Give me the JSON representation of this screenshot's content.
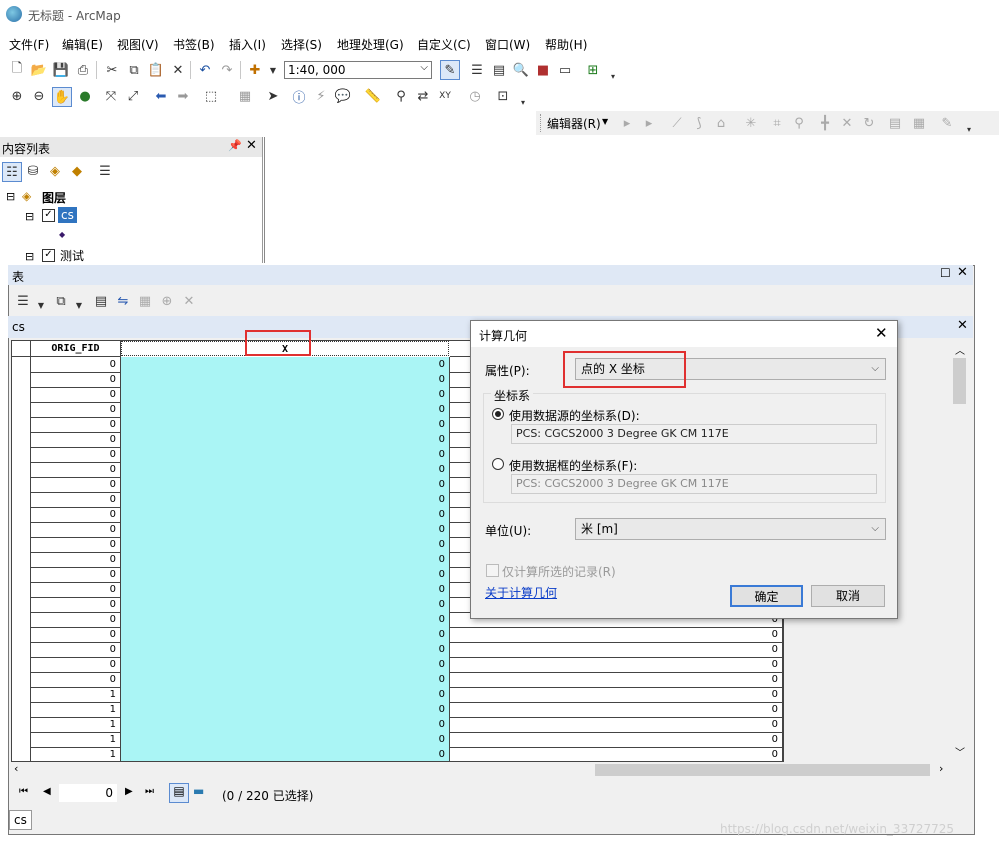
{
  "app": {
    "title": "无标题 - ArcMap"
  },
  "menu": [
    "文件(F)",
    "编辑(E)",
    "视图(V)",
    "书签(B)",
    "插入(I)",
    "选择(S)",
    "地理处理(G)",
    "自定义(C)",
    "窗口(W)",
    "帮助(H)"
  ],
  "toolbar": {
    "scale": "1:40, 000",
    "editor_label": "编辑器(R)"
  },
  "toc": {
    "title": "内容列表",
    "root": "图层",
    "layers": [
      {
        "name": "cs",
        "checked": true
      },
      {
        "name": "测试",
        "checked": true
      }
    ]
  },
  "table_window": {
    "title": "表",
    "tab_label": "cs",
    "columns": [
      "ORIG_FID",
      "X"
    ],
    "rows": [
      [
        "0",
        "0",
        "0"
      ],
      [
        "0",
        "0",
        "0"
      ],
      [
        "0",
        "0",
        "0"
      ],
      [
        "0",
        "0",
        "0"
      ],
      [
        "0",
        "0",
        "0"
      ],
      [
        "0",
        "0",
        "0"
      ],
      [
        "0",
        "0",
        "0"
      ],
      [
        "0",
        "0",
        "0"
      ],
      [
        "0",
        "0",
        "0"
      ],
      [
        "0",
        "0",
        "0"
      ],
      [
        "0",
        "0",
        "0"
      ],
      [
        "0",
        "0",
        "0"
      ],
      [
        "0",
        "0",
        "0"
      ],
      [
        "0",
        "0",
        "0"
      ],
      [
        "0",
        "0",
        "0"
      ],
      [
        "0",
        "0",
        "0"
      ],
      [
        "0",
        "0",
        "0"
      ],
      [
        "0",
        "0",
        "0"
      ],
      [
        "0",
        "0",
        "0"
      ],
      [
        "0",
        "0",
        "0"
      ],
      [
        "0",
        "0",
        "0"
      ],
      [
        "0",
        "0",
        "0"
      ],
      [
        "1",
        "0",
        "0"
      ],
      [
        "1",
        "0",
        "0"
      ],
      [
        "1",
        "0",
        "0"
      ],
      [
        "1",
        "0",
        "0"
      ],
      [
        "1",
        "0",
        "0"
      ]
    ],
    "nav_record": "0",
    "selection_status": "(0 / 220 已选择)",
    "bottom_tab": "cs"
  },
  "dialog": {
    "title": "计算几何",
    "property_label": "属性(P):",
    "property_value": "点的 X 坐标",
    "coord_group": "坐标系",
    "use_source_label": "使用数据源的坐标系(D):",
    "source_cs": "PCS: CGCS2000 3 Degree GK CM 117E",
    "use_frame_label": "使用数据框的坐标系(F):",
    "frame_cs": "PCS: CGCS2000 3 Degree GK CM 117E",
    "unit_label": "单位(U):",
    "unit_value": "米 [m]",
    "selected_only_label": "仅计算所选的记录(R)",
    "about_link": "关于计算几何",
    "ok": "确定",
    "cancel": "取消"
  },
  "watermark": "https://blog.csdn.net/weixin_33727725",
  "colors": {
    "x_column": "#aaf5f5",
    "highlight": "#e03030",
    "layer_selected": "#3074c0"
  }
}
